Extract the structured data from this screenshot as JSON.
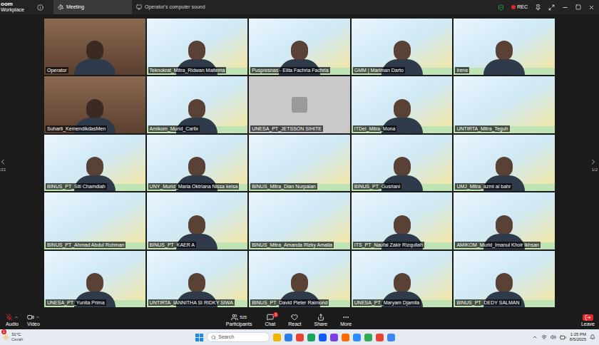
{
  "window": {
    "logo_top": "oom",
    "logo_bottom": "Workplace"
  },
  "tabs": [
    {
      "label": "Meeting",
      "selected": true
    },
    {
      "label": "Operator's computer sound",
      "selected": false
    }
  ],
  "recording": {
    "label": "REC",
    "on": true
  },
  "gallery": {
    "page_left": "/21",
    "page_right": "1/2",
    "tiles": [
      {
        "name": "Operator",
        "kind": "room"
      },
      {
        "name": "Teknokrat_Mitra_Ridwan Maitema",
        "kind": "person"
      },
      {
        "name": "Puspresnas - Elita Fachria Fachria",
        "kind": "person"
      },
      {
        "name": "GMM | Mariman Darto",
        "kind": "person"
      },
      {
        "name": "Irene",
        "kind": "person"
      },
      {
        "name": "Suharti_KemendikdasMen",
        "kind": "room"
      },
      {
        "name": "Amikom_Murid_Carlix",
        "kind": "person"
      },
      {
        "name": "UNESA_PT_JETSSON SIHITE",
        "kind": "off"
      },
      {
        "name": "ITDel_Mitra_Mona",
        "kind": "person"
      },
      {
        "name": "UNTIRTA_Mitra_Teguh",
        "kind": "banner"
      },
      {
        "name": "BINUS_PT_Siti Chamdiah",
        "kind": "person"
      },
      {
        "name": "UNY_Murid_Maria Oktriana Nissa keisa",
        "kind": "person"
      },
      {
        "name": "BINUS_Mitra_Dian Nurpaian",
        "kind": "banner"
      },
      {
        "name": "BINUS_PT_Gusriani",
        "kind": "person"
      },
      {
        "name": "UMJ_Mitra_azmi al bahr",
        "kind": "person"
      },
      {
        "name": "BINUS_PT_Ahmad Abdul Rohman",
        "kind": "banner"
      },
      {
        "name": "BINUS_PT_KAER A",
        "kind": "person"
      },
      {
        "name": "BINUS_Mitra_Amanda Rizky Amalia",
        "kind": "banner"
      },
      {
        "name": "ITS_PT_Naufal Zakir Rizqullah",
        "kind": "person"
      },
      {
        "name": "AMIKOM_Murid_Imanul Khoir Ikhsan",
        "kind": "person"
      },
      {
        "name": "UNESA_PT_Yunita Prima",
        "kind": "person"
      },
      {
        "name": "UNTIRTA_IANNITHA SI RIDKY SIWA",
        "kind": "person"
      },
      {
        "name": "BINUS_PT_David Pieter Raimond",
        "kind": "person"
      },
      {
        "name": "UNESA_PT_Maryam Djamila",
        "kind": "person"
      },
      {
        "name": "BINUS_PT_DEDY SALMAN",
        "kind": "person"
      }
    ]
  },
  "toolbar": {
    "audio": {
      "label": "Audio",
      "muted": true
    },
    "video": {
      "label": "Video"
    },
    "participants": {
      "label": "Participants",
      "count": "525"
    },
    "chat": {
      "label": "Chat",
      "badge": "1"
    },
    "react": {
      "label": "React"
    },
    "share": {
      "label": "Share"
    },
    "more": {
      "label": "More"
    },
    "leave": {
      "label": "Leave"
    }
  },
  "taskbar": {
    "weather": {
      "temp": "31°C",
      "desc": "Cerah",
      "badge": "1"
    },
    "search": {
      "placeholder": "Search"
    },
    "time": "1:25 PM",
    "date": "8/5/2025"
  }
}
